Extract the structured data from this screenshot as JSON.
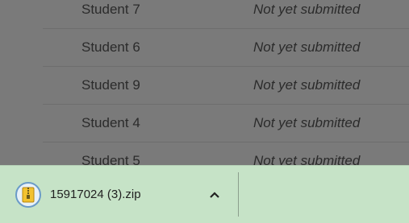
{
  "submissions": {
    "rows": [
      {
        "student": "Student 7",
        "status": "Not yet submitted"
      },
      {
        "student": "Student 6",
        "status": "Not yet submitted"
      },
      {
        "student": "Student 9",
        "status": "Not yet submitted"
      },
      {
        "student": "Student 4",
        "status": "Not yet submitted"
      },
      {
        "student": "Student 5",
        "status": "Not yet submitted"
      }
    ]
  },
  "downloads": {
    "file": {
      "name": "15917024 (3).zip",
      "icon": "zip-archive-icon",
      "menu_icon": "chevron-up-icon"
    }
  }
}
